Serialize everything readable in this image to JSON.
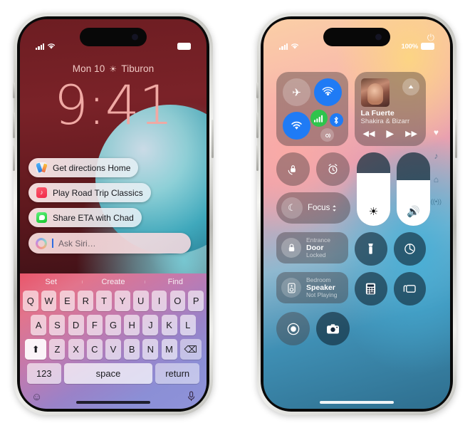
{
  "page": {
    "background": "#ffffff"
  },
  "left_phone": {
    "device": "iPhone lock screen with Siri suggestions and keyboard",
    "status_bar": {
      "signal": "signal-bars",
      "wifi": "wifi-icon",
      "battery": "battery-icon"
    },
    "lock_screen": {
      "date": "Mon 10",
      "weather_icon": "☀",
      "location": "Tiburon",
      "time": "9:41"
    },
    "siri_suggestions": [
      {
        "icon": "maps-icon",
        "label": "Get directions Home"
      },
      {
        "icon": "music-icon",
        "label": "Play Road Trip Classics"
      },
      {
        "icon": "messages-icon",
        "label": "Share ETA with Chad"
      }
    ],
    "ask_siri": {
      "icon": "siri-orb-icon",
      "placeholder": "Ask Siri…",
      "value": ""
    },
    "keyboard": {
      "predictions": [
        "Set",
        "Create",
        "Find"
      ],
      "row1": [
        "Q",
        "W",
        "E",
        "R",
        "T",
        "Y",
        "U",
        "I",
        "O",
        "P"
      ],
      "row2": [
        "A",
        "S",
        "D",
        "F",
        "G",
        "H",
        "J",
        "K",
        "L"
      ],
      "row3": [
        "Z",
        "X",
        "C",
        "V",
        "B",
        "N",
        "M"
      ],
      "shift_icon": "⬆",
      "delete_icon": "⌫",
      "numbers_key": "123",
      "space_key": "space",
      "return_key": "return",
      "emoji_icon": "☺",
      "mic_icon": "mic-icon"
    }
  },
  "right_phone": {
    "device": "iPhone Control Center",
    "status_bar": {
      "signal": "signal-bars",
      "wifi": "wifi-icon",
      "battery_percent": "100%",
      "battery": "battery-icon"
    },
    "power_icon": "power-icon",
    "connectivity": {
      "airplane_mode": {
        "icon": "airplane-icon",
        "state": "off"
      },
      "airdrop": {
        "icon": "airdrop-icon",
        "state": "on"
      },
      "wifi": {
        "icon": "wifi-icon",
        "state": "on"
      },
      "cellular": {
        "icon": "cellular-icon",
        "state": "on"
      },
      "bluetooth": {
        "icon": "bluetooth-icon",
        "state": "on"
      },
      "hotspot": {
        "icon": "hotspot-icon",
        "state": "off"
      }
    },
    "now_playing": {
      "album_art": "album-art",
      "airplay_icon": "airplay-icon",
      "title": "La Fuerte",
      "artist": "Shakira & Bizarr",
      "previous_icon": "◀◀",
      "play_icon": "▶",
      "next_icon": "▶▶"
    },
    "rotation_lock": {
      "icon": "rotation-lock-icon"
    },
    "alarm": {
      "icon": "alarm-clock-icon"
    },
    "focus": {
      "icon": "moon-icon",
      "label": "Focus",
      "chevron": "⌃⌄"
    },
    "brightness_slider": {
      "icon": "sun-icon",
      "value": 72
    },
    "volume_slider": {
      "icon": "speaker-icon",
      "value": 62
    },
    "home_controls": [
      {
        "icon": "lock-icon",
        "room": "Entrance",
        "name": "Door",
        "state": "Locked"
      },
      {
        "icon": "speaker-device-icon",
        "room": "Bedroom",
        "name": "Speaker",
        "state": "Not Playing"
      }
    ],
    "flashlight": {
      "icon": "flashlight-icon"
    },
    "timer": {
      "icon": "timer-icon"
    },
    "calculator": {
      "icon": "calculator-icon"
    },
    "screen_mirroring": {
      "icon": "screen-mirroring-icon"
    },
    "screen_record": {
      "icon": "record-icon"
    },
    "camera": {
      "icon": "camera-icon"
    },
    "page_icons": [
      "♥",
      "♪",
      "⌂",
      "((•))"
    ]
  }
}
